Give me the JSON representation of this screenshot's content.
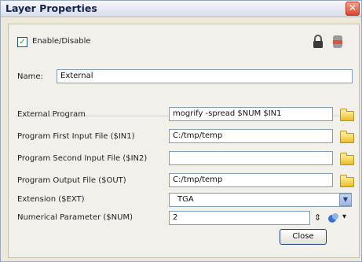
{
  "window": {
    "title": "Layer Properties",
    "close_glyph": "✕"
  },
  "enable": {
    "label": "Enable/Disable",
    "checked": true,
    "check_glyph": "✓"
  },
  "name": {
    "label": "Name:",
    "value": "External"
  },
  "fields": [
    {
      "label": "External Program",
      "value": "mogrify -spread $NUM $IN1"
    },
    {
      "label": "Program First Input File ($IN1)",
      "value": "C:/tmp/temp"
    },
    {
      "label": "Program Second Input File ($IN2)",
      "value": ""
    },
    {
      "label": "Program Output File ($OUT)",
      "value": "C:/tmp/temp"
    }
  ],
  "extension": {
    "label": "Extension ($EXT)",
    "value": "TGA",
    "arrow_glyph": "▼"
  },
  "numparam": {
    "label": "Numerical Parameter ($NUM)",
    "value": "2",
    "stepper_glyph": "⇕",
    "menu_glyph": "▾"
  },
  "close_button": {
    "label": "Close"
  },
  "icons": [
    "lock-icon",
    "layer-color-icon",
    "folder-icon",
    "stepper-icon",
    "link-icon"
  ]
}
